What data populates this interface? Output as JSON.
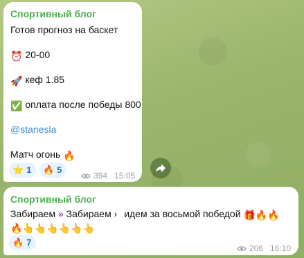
{
  "colors": {
    "background": "#a3bf78",
    "channel_name": "#4caf50",
    "link": "#3a8fd4",
    "reaction_bg": "#e7f3ff",
    "reaction_text": "#2e6fb0"
  },
  "message1": {
    "channel": "Спортивный блог",
    "lines": [
      "Готов прогноз на баскет",
      "20-00",
      "кеф 1.85",
      "оплата после победы 800",
      "@stanesla",
      "Матч огонь"
    ],
    "emojis": {
      "time": "⏰",
      "rocket": "🚀",
      "check": "✅",
      "fire": "🔥"
    },
    "reactions": [
      {
        "emoji": "⭐",
        "count": "1"
      },
      {
        "emoji": "🔥",
        "count": "5"
      }
    ],
    "views": "394",
    "time": "15:05"
  },
  "message2": {
    "channel": "Спортивный блог",
    "text_part1": "Забираем",
    "arrow1": "»",
    "text_part2": "Забираем",
    "arrow2": "›",
    "text_part3": "идем за восьмой победой",
    "line1_emojis": "🎁🔥🔥",
    "line2_emojis": "🔥👆👆👆👆👆👆",
    "reactions": [
      {
        "emoji": "🔥",
        "count": "7"
      }
    ],
    "views": "206",
    "time": "16:10"
  }
}
